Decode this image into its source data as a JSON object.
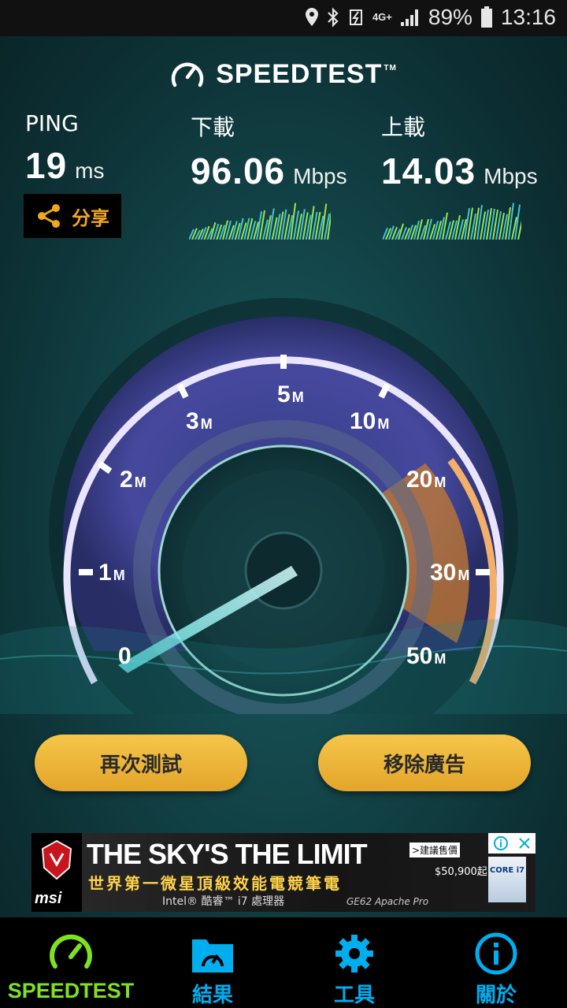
{
  "status_bar": {
    "battery": "89%",
    "time": "13:16",
    "network": "4G+"
  },
  "app": {
    "brand": "SPEEDTEST",
    "trademark": "TM"
  },
  "results": {
    "ping": {
      "label": "PING",
      "value": "19",
      "unit": "ms"
    },
    "download": {
      "label": "下載",
      "value": "96.06",
      "unit": "Mbps"
    },
    "upload": {
      "label": "上載",
      "value": "14.03",
      "unit": "Mbps"
    }
  },
  "share_label": "分享",
  "gauge": {
    "scale": [
      {
        "text": "0",
        "unit": ""
      },
      {
        "text": "1",
        "unit": "M"
      },
      {
        "text": "2",
        "unit": "M"
      },
      {
        "text": "3",
        "unit": "M"
      },
      {
        "text": "5",
        "unit": "M"
      },
      {
        "text": "10",
        "unit": "M"
      },
      {
        "text": "20",
        "unit": "M"
      },
      {
        "text": "30",
        "unit": "M"
      },
      {
        "text": "50",
        "unit": "M"
      }
    ],
    "needle_value": "0"
  },
  "buttons": {
    "retest": "再次測試",
    "remove_ads": "移除廣告"
  },
  "ad": {
    "headline": "THE SKY'S THE LIMIT",
    "subline": "世界第一微星頂級效能電競筆電",
    "small_line": "Intel® 酷睿™ i7 處理器",
    "model": "GE62 Apache Pro",
    "tag": ">建議售價",
    "price": "$50,900起",
    "brand": "msi",
    "badge": "CORE i7"
  },
  "nav": [
    {
      "label": "SPEEDTEST",
      "active": true
    },
    {
      "label": "結果",
      "active": false
    },
    {
      "label": "工具",
      "active": false
    },
    {
      "label": "關於",
      "active": false
    }
  ]
}
